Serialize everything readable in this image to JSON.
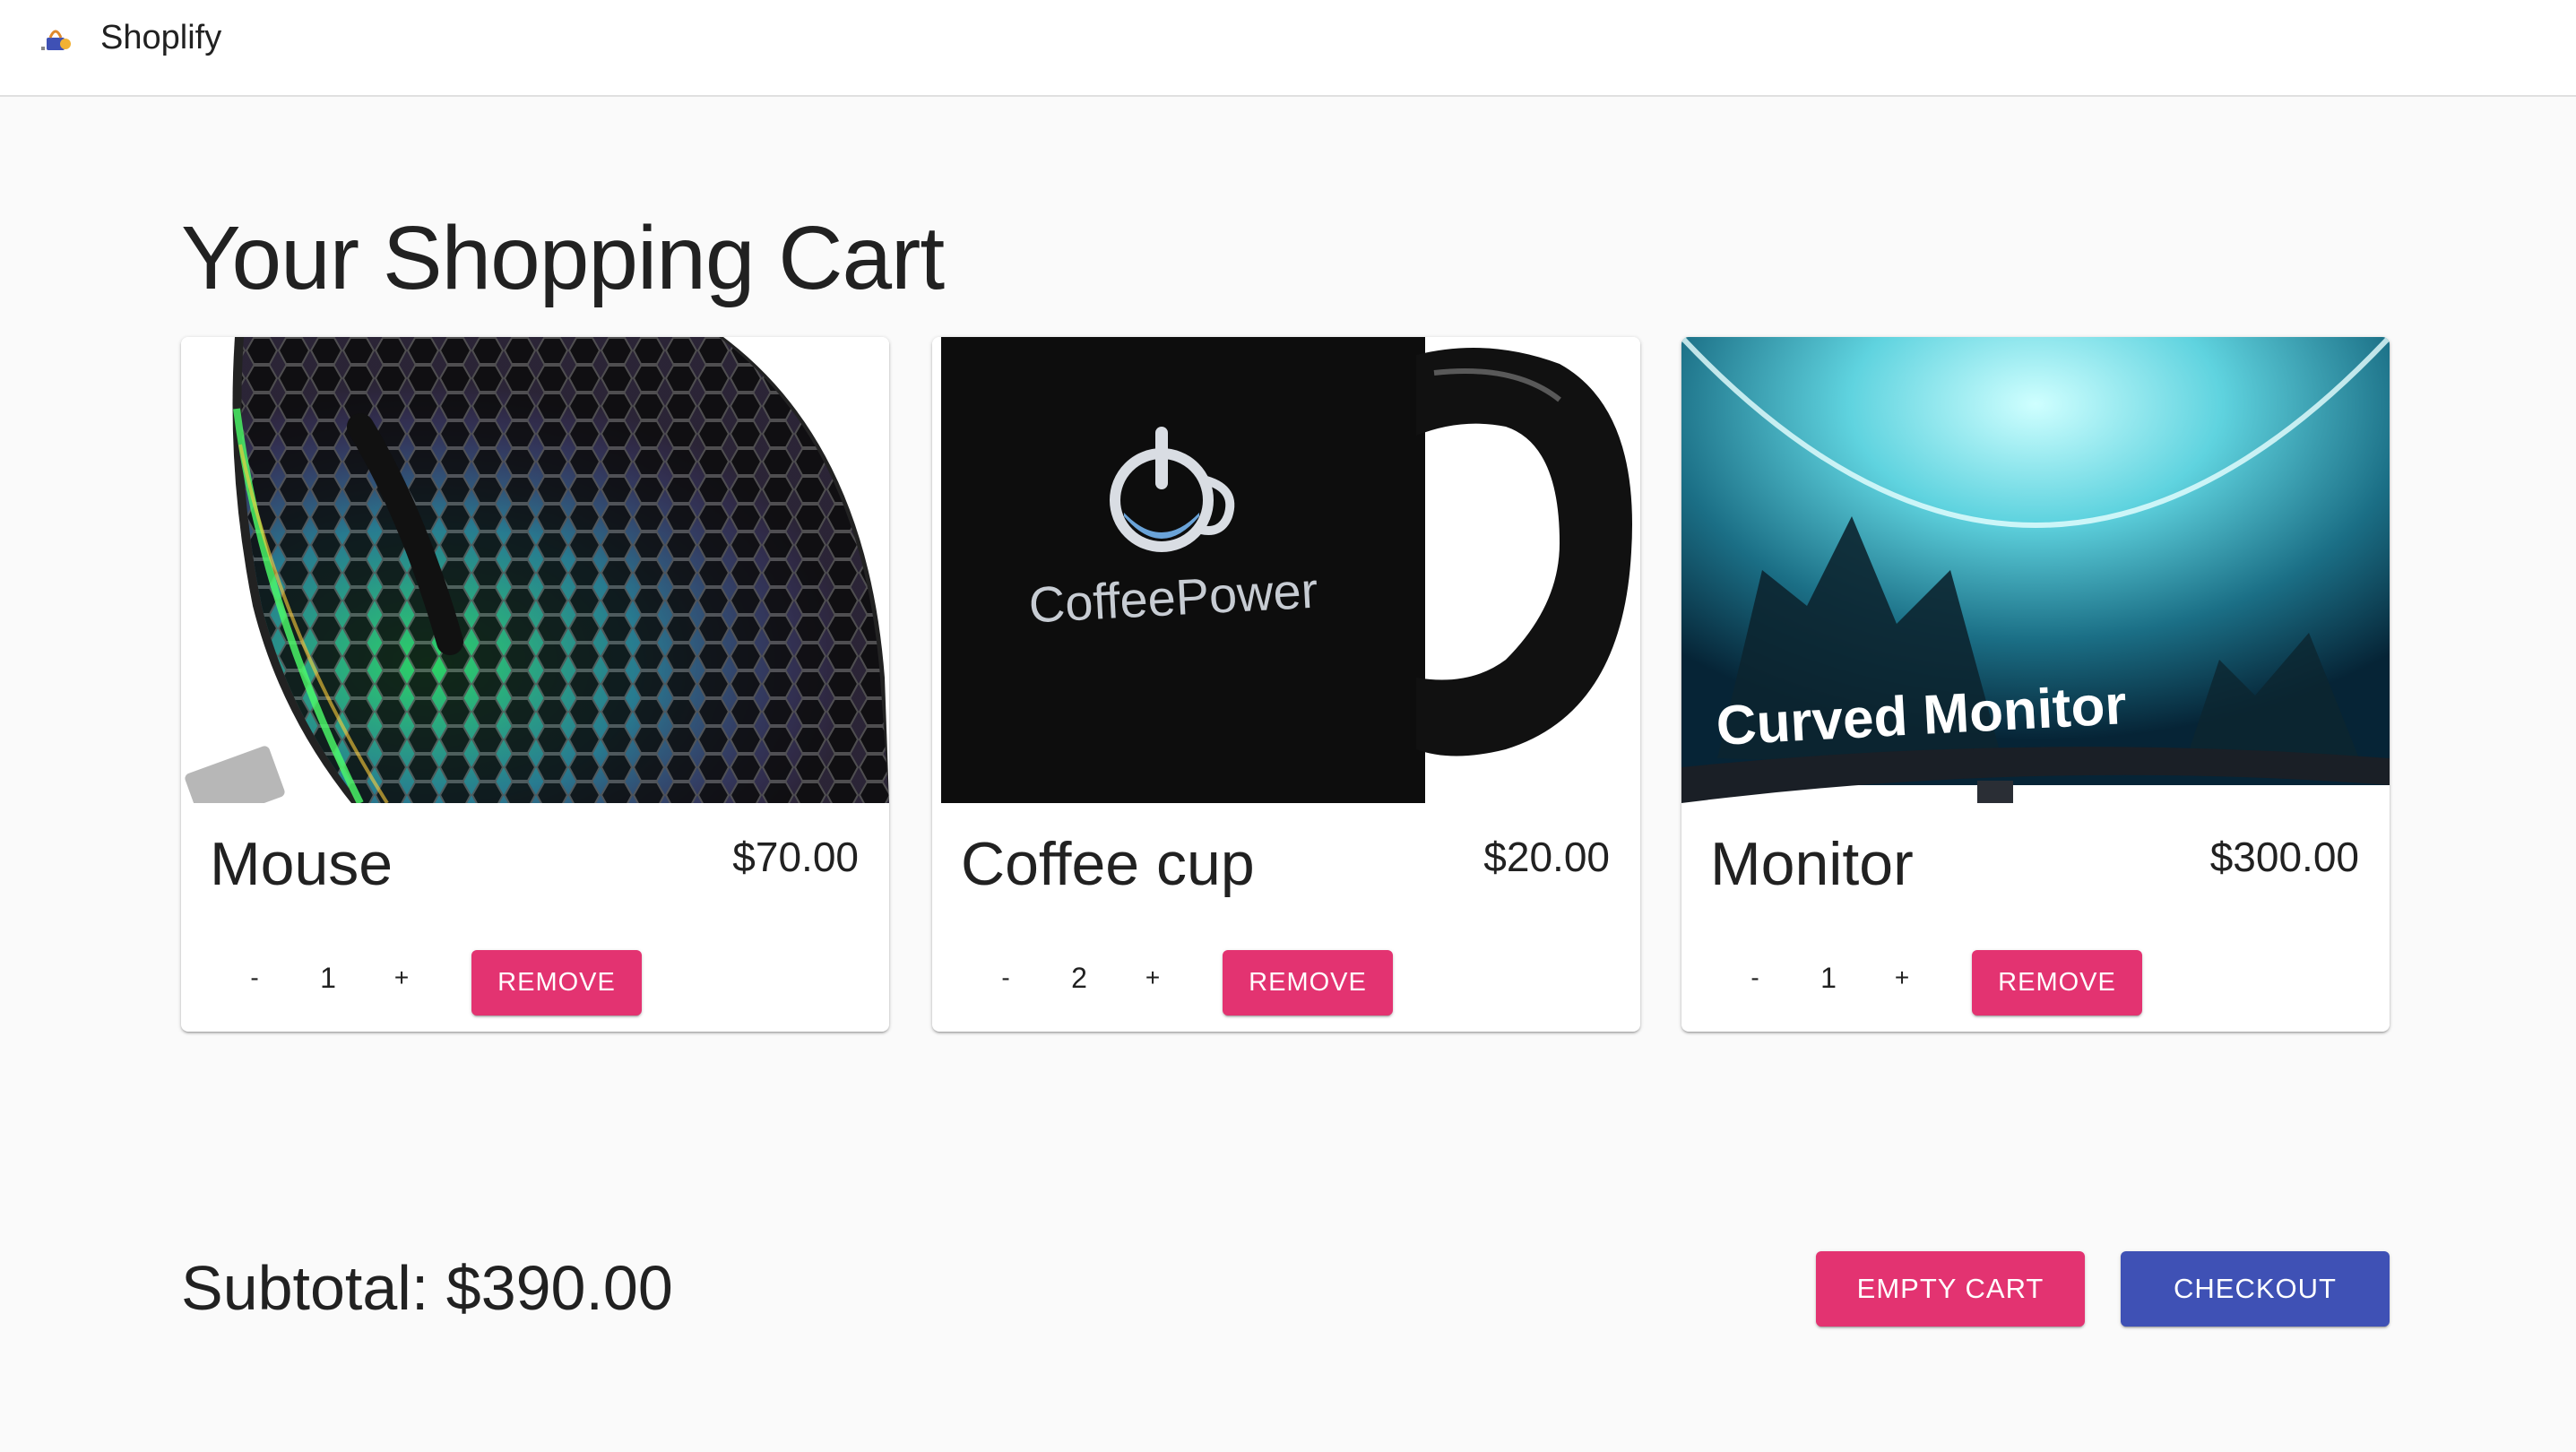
{
  "app": {
    "name": "Shoplify"
  },
  "page": {
    "title": "Your Shopping Cart"
  },
  "cart": {
    "items": [
      {
        "name": "Mouse",
        "price": "$70.00",
        "quantity": "1",
        "decrement_label": "-",
        "increment_label": "+",
        "remove_label": "REMOVE"
      },
      {
        "name": "Coffee cup",
        "price": "$20.00",
        "quantity": "2",
        "decrement_label": "-",
        "increment_label": "+",
        "remove_label": "REMOVE",
        "image_text": "CoffeePower"
      },
      {
        "name": "Monitor",
        "price": "$300.00",
        "quantity": "1",
        "decrement_label": "-",
        "increment_label": "+",
        "remove_label": "REMOVE",
        "image_text": "Curved Monitor"
      }
    ],
    "subtotal": "Subtotal: $390.00",
    "empty_label": "EMPTY CART",
    "checkout_label": "CHECKOUT"
  },
  "colors": {
    "secondary": "#e33371",
    "primary": "#3f51b5",
    "background": "#fafafa"
  },
  "icons": {
    "brand": "shop-logo-icon"
  }
}
